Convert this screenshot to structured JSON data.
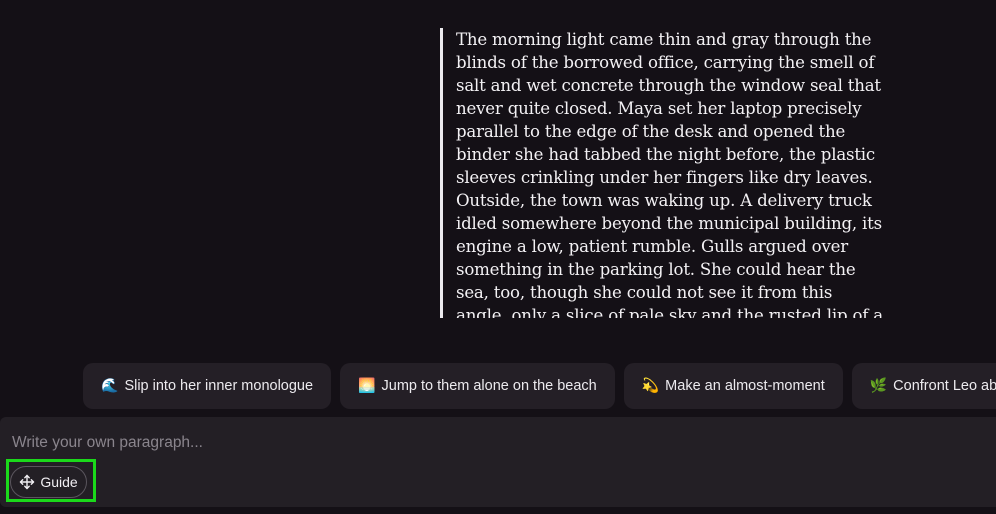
{
  "story": {
    "paragraph": "The morning light came thin and gray through the blinds of the borrowed office, carrying the smell of salt and wet concrete through the window seal that never quite closed. Maya set her laptop precisely parallel to the edge of the desk and opened the binder she had tabbed the night before, the plastic sleeves crinkling under her fingers like dry leaves. Outside, the town was waking up. A delivery truck idled somewhere beyond the municipal building, its engine a low, patient rumble. Gulls argued over something in the parking lot. She could hear the sea, too, though she could not see it from this angle, only a slice of pale sky and the rusted lip of a dumpster."
  },
  "suggestions": [
    {
      "emoji": "🌊",
      "label": "Slip into her inner monologue"
    },
    {
      "emoji": "🌅",
      "label": "Jump to them alone on the beach"
    },
    {
      "emoji": "💫",
      "label": "Make an almost-moment"
    },
    {
      "emoji": "🌿",
      "label": "Confront Leo about t"
    }
  ],
  "composer": {
    "placeholder": "Write your own paragraph...",
    "guide_label": "Guide",
    "guide_icon": "move-arrows-icon",
    "highlight_color": "#1bd91b"
  }
}
